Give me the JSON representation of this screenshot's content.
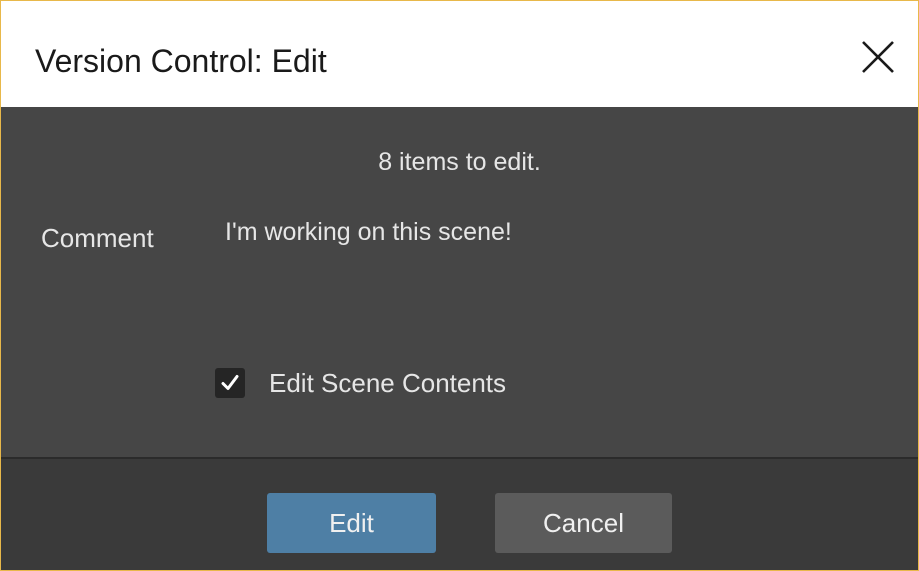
{
  "window": {
    "title": "Version Control: Edit"
  },
  "body": {
    "items_text": "8 items to edit.",
    "comment_label": "Comment",
    "comment_value": "I'm working on this scene!",
    "checkbox": {
      "label": "Edit Scene Contents",
      "checked": true
    }
  },
  "footer": {
    "edit_label": "Edit",
    "cancel_label": "Cancel"
  },
  "colors": {
    "accent": "#4e7fa5",
    "panel": "#464646",
    "footer": "#3a3a3a",
    "window_border": "#e8b84a"
  },
  "icons": {
    "close": "close-icon",
    "check": "checkmark-icon"
  }
}
